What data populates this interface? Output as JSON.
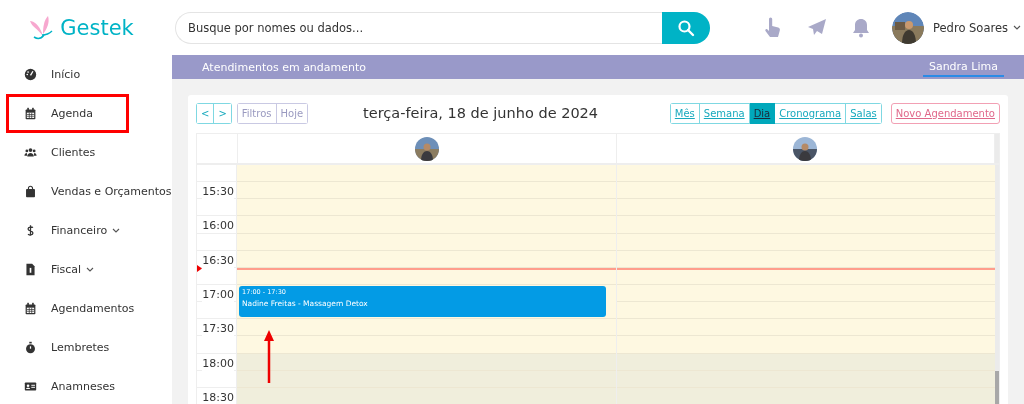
{
  "logo": {
    "text": "Gestek"
  },
  "sidebar": {
    "items": [
      {
        "label": "Início",
        "kind": "gauge",
        "has_submenu": false,
        "highlighted": false
      },
      {
        "label": "Agenda",
        "kind": "calendar",
        "has_submenu": false,
        "highlighted": true
      },
      {
        "label": "Clientes",
        "kind": "users",
        "has_submenu": false,
        "highlighted": false
      },
      {
        "label": "Vendas e Orçamentos",
        "kind": "bag",
        "has_submenu": false,
        "highlighted": false
      },
      {
        "label": "Financeiro",
        "kind": "dollar",
        "has_submenu": true,
        "highlighted": false
      },
      {
        "label": "Fiscal",
        "kind": "file",
        "has_submenu": true,
        "highlighted": false
      },
      {
        "label": "Agendamentos",
        "kind": "calendar",
        "has_submenu": false,
        "highlighted": false
      },
      {
        "label": "Lembretes",
        "kind": "stopwatch",
        "has_submenu": false,
        "highlighted": false
      },
      {
        "label": "Anamneses",
        "kind": "idcard",
        "has_submenu": false,
        "highlighted": false
      }
    ]
  },
  "search": {
    "placeholder": "Busque por nomes ou dados..."
  },
  "user": {
    "name": "Pedro Soares"
  },
  "in_progress_bar": {
    "title": "Atendimentos em andamento",
    "tabs": [
      {
        "label": "Sandra Lima",
        "selected": true
      }
    ]
  },
  "toolbar": {
    "nav": [
      "<",
      ">"
    ],
    "buttons": [
      "Filtros",
      "Hoje"
    ],
    "title": "terça-feira, 18 de junho de 2024",
    "views": [
      {
        "label": "Mês",
        "selected": false
      },
      {
        "label": "Semana",
        "selected": false
      },
      {
        "label": "Dia",
        "selected": true
      },
      {
        "label": "Cronograma",
        "selected": false
      },
      {
        "label": "Salas",
        "selected": false
      }
    ],
    "new_button": "Novo Agendamento"
  },
  "calendar": {
    "slots": [
      {
        "shaded": false,
        "now": false
      },
      {
        "label": "15:30",
        "shaded": false,
        "now": false
      },
      {
        "shaded": false,
        "now": false
      },
      {
        "label": "16:00",
        "shaded": false,
        "now": false
      },
      {
        "shaded": false,
        "now": false
      },
      {
        "label": "16:30",
        "shaded": false,
        "now": false
      },
      {
        "shaded": false,
        "now": true
      },
      {
        "label": "17:00",
        "shaded": false,
        "now": false,
        "events": [
          {
            "time": "17:00 - 17:30",
            "title": "Nadine Freitas - Massagem Detox"
          }
        ]
      },
      {
        "shaded": false,
        "now": false
      },
      {
        "label": "17:30",
        "shaded": false,
        "now": false
      },
      {
        "shaded": false,
        "now": false
      },
      {
        "label": "18:00",
        "shaded": true,
        "now": false
      },
      {
        "shaded": true,
        "now": false
      },
      {
        "label": "18:30",
        "shaded": true,
        "now": false
      }
    ]
  }
}
